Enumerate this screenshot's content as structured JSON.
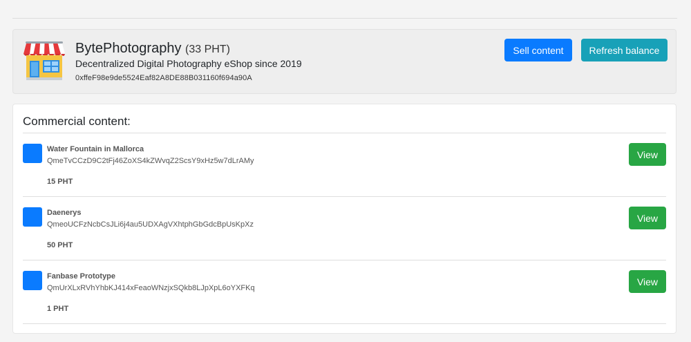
{
  "shop": {
    "name": "BytePhotography",
    "balance": "(33 PHT)",
    "description": "Decentralized Digital Photography eShop since 2019",
    "address": "0xffeF98e9de5524Eaf82A8DE88B031160f694a90A",
    "icon": "storefront-icon"
  },
  "actions": {
    "sell_label": "Sell content",
    "refresh_label": "Refresh balance"
  },
  "colors": {
    "primary": "#0a7bff",
    "info": "#18a1b8",
    "success": "#28a644"
  },
  "content": {
    "title": "Commercial content:",
    "items": [
      {
        "title": "Water Fountain in Mallorca",
        "hash": "QmeTvCCzD9C2tFj46ZoXS4kZWvqZ2ScsY9xHz5w7dLrAMy",
        "price": "15 PHT",
        "view_label": "View"
      },
      {
        "title": "Daenerys",
        "hash": "QmeoUCFzNcbCsJLi6j4au5UDXAgVXhtphGbGdcBpUsKpXz",
        "price": "50 PHT",
        "view_label": "View"
      },
      {
        "title": "Fanbase Prototype",
        "hash": "QmUrXLxRVhYhbKJ414xFeaoWNzjxSQkb8LJpXpL6oYXFKq",
        "price": "1 PHT",
        "view_label": "View"
      }
    ]
  }
}
